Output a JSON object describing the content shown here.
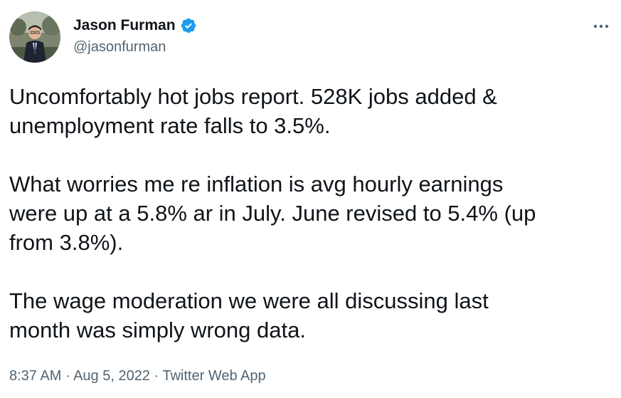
{
  "author": {
    "display_name": "Jason Furman",
    "handle": "@jasonfurman",
    "verified": true,
    "verified_badge_color": "#1d9bf0"
  },
  "icons": {
    "avatar": "profile-photo",
    "verified": "verified-badge-icon",
    "more": "more-options-icon"
  },
  "tweet": {
    "paragraphs": [
      "Uncomfortably hot jobs report. 528K jobs added &\nunemployment rate falls to 3.5%.",
      "What worries me re inflation is avg hourly earnings\nwere up at a 5.8% ar in July. June revised to 5.4% (up\nfrom 3.8%).",
      "The wage moderation we were all discussing last\nmonth was simply wrong data."
    ]
  },
  "meta": {
    "time": "8:37 AM",
    "separator": " · ",
    "date": "Aug 5, 2022",
    "source": "Twitter Web App"
  },
  "colors": {
    "text_primary": "#0f1419",
    "text_secondary": "#536471",
    "accent": "#1d9bf0"
  }
}
